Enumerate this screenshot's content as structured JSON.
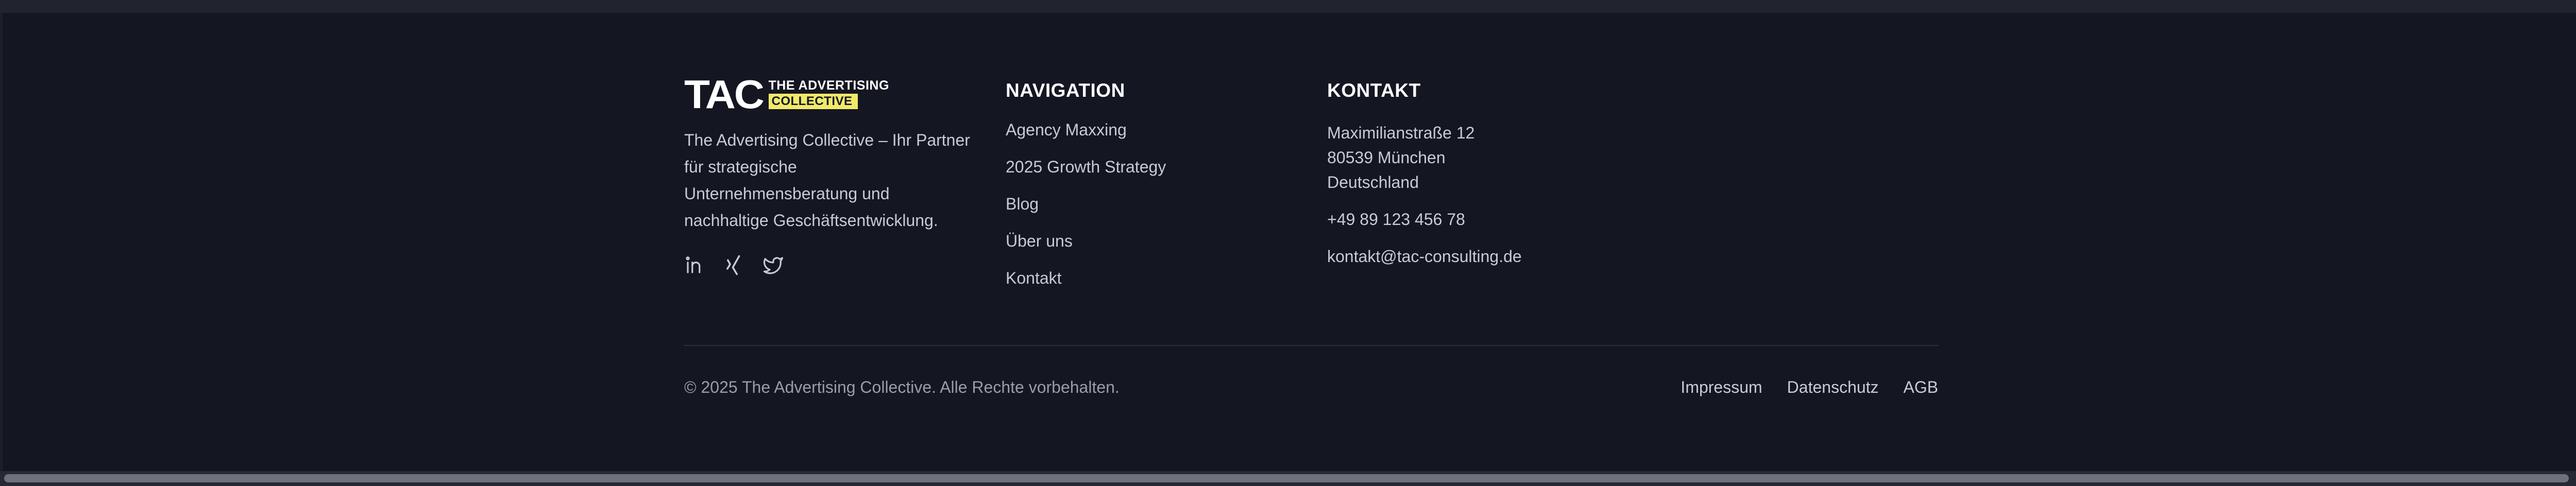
{
  "brand": {
    "logo_main": "TAC",
    "logo_line1": "THE ADVERTISING",
    "logo_line2": "COLLECTIVE",
    "description": "The Advertising Collective – Ihr Partner für strategische Unternehmensberatung und nachhaltige Geschäftsentwicklung.",
    "accent_color": "#f1e96a",
    "social": [
      {
        "icon": "linkedin-icon"
      },
      {
        "icon": "xing-icon"
      },
      {
        "icon": "twitter-icon"
      }
    ]
  },
  "navigation": {
    "heading": "NAVIGATION",
    "items": [
      {
        "label": "Agency Maxxing"
      },
      {
        "label": "2025 Growth Strategy"
      },
      {
        "label": "Blog"
      },
      {
        "label": "Über uns"
      },
      {
        "label": "Kontakt"
      }
    ]
  },
  "contact": {
    "heading": "KONTAKT",
    "street": "Maximilianstraße 12",
    "city": "80539 München",
    "country": "Deutschland",
    "phone": "+49 89 123 456 78",
    "email": "kontakt@tac-consulting.de"
  },
  "bottom": {
    "copyright": "© 2025 The Advertising Collective. Alle Rechte vorbehalten.",
    "links": [
      {
        "label": "Impressum"
      },
      {
        "label": "Datenschutz"
      },
      {
        "label": "AGB"
      }
    ]
  },
  "colors": {
    "background": "#141622",
    "text_muted": "#c9cbd4",
    "divider": "#2c2f3c"
  }
}
